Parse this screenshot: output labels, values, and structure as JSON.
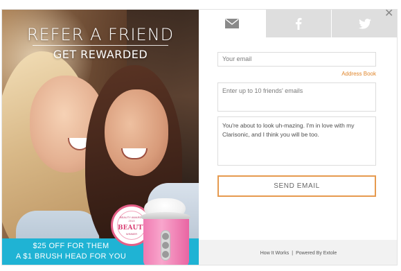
{
  "hero": {
    "title": "REFER A FRIEND",
    "subtitle": "GET REWARDED",
    "promo_line1": "$25 OFF FOR THEM",
    "promo_line2": "A $1 BRUSH HEAD FOR YOU"
  },
  "badge": {
    "top_text": "BEAUTY AWARDS 2013",
    "main_text": "BEAUTY",
    "bottom_text": "WINNER"
  },
  "tabs": [
    {
      "icon": "mail-icon",
      "active": true
    },
    {
      "icon": "facebook-icon",
      "active": false
    },
    {
      "icon": "twitter-icon",
      "active": false
    }
  ],
  "form": {
    "email_placeholder": "Your email",
    "address_book_label": "Address Book",
    "friends_placeholder": "Enter up to 10 friends' emails",
    "message": "You're about to look uh-mazing. I'm in love with my Clarisonic, and I think you will be too.",
    "send_label": "SEND EMAIL"
  },
  "footer": {
    "how_it_works": "How It Works",
    "separator": "|",
    "powered_by": "Powered By Extole"
  },
  "colors": {
    "accent": "#e0862c",
    "promo_bar": "#1fb3d4",
    "tab_inactive": "#dedede"
  }
}
